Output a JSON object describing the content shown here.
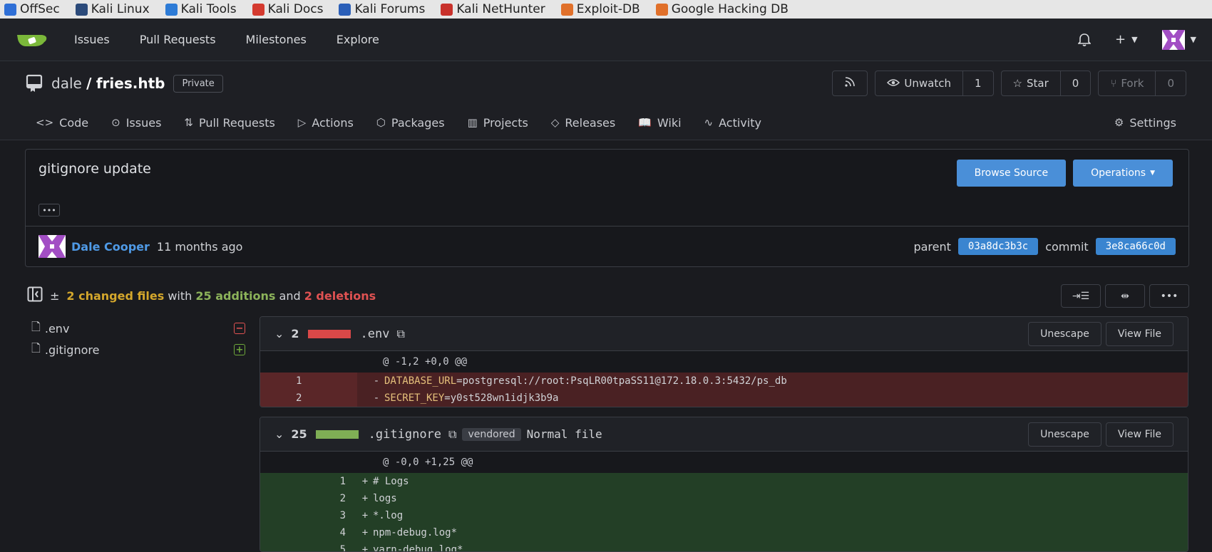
{
  "bookmarks": [
    {
      "label": "OffSec",
      "icon": "offsec-icon",
      "color": "#2f6fd6"
    },
    {
      "label": "Kali Linux",
      "icon": "kali-dragon-icon",
      "color": "#2b4a7a"
    },
    {
      "label": "Kali Tools",
      "icon": "kali-tools-icon",
      "color": "#2d7bd6"
    },
    {
      "label": "Kali Docs",
      "icon": "kali-docs-icon",
      "color": "#d43a2f"
    },
    {
      "label": "Kali Forums",
      "icon": "kali-forums-icon",
      "color": "#2b5fb8"
    },
    {
      "label": "Kali NetHunter",
      "icon": "nethunter-icon",
      "color": "#c8312b"
    },
    {
      "label": "Exploit-DB",
      "icon": "exploitdb-icon",
      "color": "#e0702a"
    },
    {
      "label": "Google Hacking DB",
      "icon": "ghdb-icon",
      "color": "#e0702a"
    }
  ],
  "topnav": {
    "items": [
      "Issues",
      "Pull Requests",
      "Milestones",
      "Explore"
    ]
  },
  "repo": {
    "owner": "dale",
    "separator": "/",
    "name": "fries.htb",
    "visibility": "Private",
    "unwatch_label": "Unwatch",
    "watch_count": "1",
    "star_label": "Star",
    "star_count": "0",
    "fork_label": "Fork",
    "fork_count": "0"
  },
  "tabs": [
    {
      "label": "Code",
      "icon": "code-icon",
      "glyph": "<>"
    },
    {
      "label": "Issues",
      "icon": "issue-icon",
      "glyph": "⊙"
    },
    {
      "label": "Pull Requests",
      "icon": "pull-request-icon",
      "glyph": "⇅"
    },
    {
      "label": "Actions",
      "icon": "play-icon",
      "glyph": "▷"
    },
    {
      "label": "Packages",
      "icon": "package-icon",
      "glyph": "⬡"
    },
    {
      "label": "Projects",
      "icon": "project-icon",
      "glyph": "▥"
    },
    {
      "label": "Releases",
      "icon": "tag-icon",
      "glyph": "◇"
    },
    {
      "label": "Wiki",
      "icon": "book-icon",
      "glyph": "📖"
    },
    {
      "label": "Activity",
      "icon": "pulse-icon",
      "glyph": "∿"
    }
  ],
  "settings_label": "Settings",
  "commit": {
    "title": "gitignore update",
    "ellipsis": "•••",
    "browse_source": "Browse Source",
    "operations": "Operations",
    "author": "Dale Cooper",
    "time": "11 months ago",
    "parent_label": "parent",
    "parent_sha": "03a8dc3b3c",
    "commit_label": "commit",
    "commit_sha": "3e8ca66c0d"
  },
  "stats": {
    "pm": "±",
    "changed": "2 changed files",
    "with": "with",
    "additions": "25 additions",
    "and": "and",
    "deletions": "2 deletions"
  },
  "files": [
    {
      "name": ".env",
      "status": "deleted"
    },
    {
      "name": ".gitignore",
      "status": "added"
    }
  ],
  "diffs": {
    "env": {
      "count": "2",
      "name": ".env",
      "hunk": "@ -1,2 +0,0 @@",
      "lines": [
        {
          "num": "1",
          "sign": "-",
          "key": "DATABASE_URL",
          "eq": "=",
          "value": "postgresql://root:PsqLR00tpaSS11@172.18.0.3:5432/ps_db"
        },
        {
          "num": "2",
          "sign": "-",
          "key": "SECRET_KEY",
          "eq": "=",
          "value": "y0st528wn1idjk3b9a"
        }
      ]
    },
    "gitignore": {
      "count": "25",
      "name": ".gitignore",
      "vendored": "vendored",
      "filetype": "Normal file",
      "hunk": "@ -0,0 +1,25 @@",
      "lines": [
        {
          "num": "1",
          "sign": "+",
          "text": "# Logs"
        },
        {
          "num": "2",
          "sign": "+",
          "text": "logs"
        },
        {
          "num": "3",
          "sign": "+",
          "text": "*.log"
        },
        {
          "num": "4",
          "sign": "+",
          "text": "npm-debug.log*"
        },
        {
          "num": "5",
          "sign": "+",
          "text": "yarn-debug.log*"
        }
      ]
    },
    "unescape": "Unescape",
    "view_file": "View File"
  }
}
